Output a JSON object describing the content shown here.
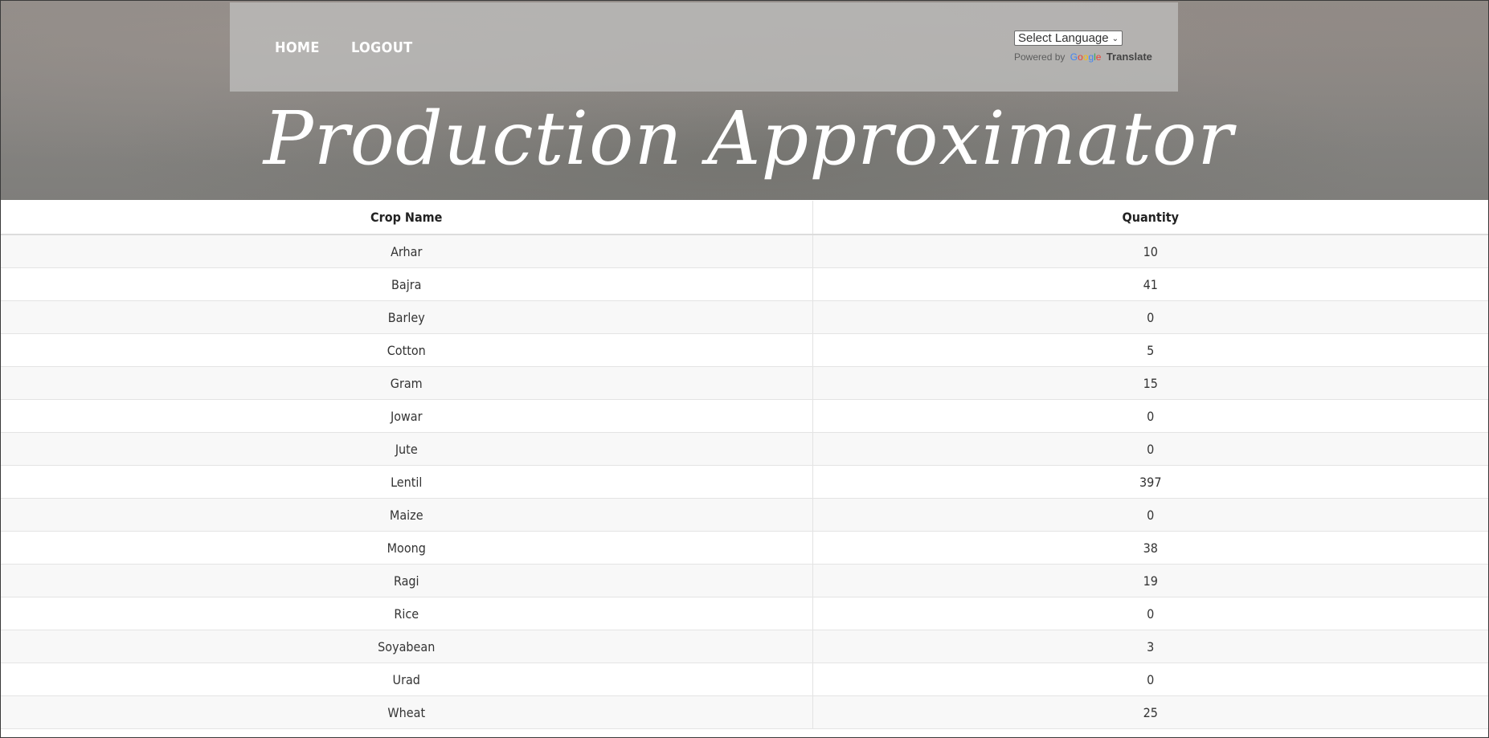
{
  "nav": {
    "home_label": "HOME",
    "logout_label": "LOGOUT"
  },
  "translate": {
    "select_value": "Select Language",
    "powered_by": "Powered by",
    "google_logo": "Google",
    "translate_label": "Translate"
  },
  "hero": {
    "title": "Production Approximator"
  },
  "table": {
    "headers": [
      "Crop Name",
      "Quantity"
    ],
    "rows": [
      [
        "Arhar",
        "10"
      ],
      [
        "Bajra",
        "41"
      ],
      [
        "Barley",
        "0"
      ],
      [
        "Cotton",
        "5"
      ],
      [
        "Gram",
        "15"
      ],
      [
        "Jowar",
        "0"
      ],
      [
        "Jute",
        "0"
      ],
      [
        "Lentil",
        "397"
      ],
      [
        "Maize",
        "0"
      ],
      [
        "Moong",
        "38"
      ],
      [
        "Ragi",
        "19"
      ],
      [
        "Rice",
        "0"
      ],
      [
        "Soyabean",
        "3"
      ],
      [
        "Urad",
        "0"
      ],
      [
        "Wheat",
        "25"
      ]
    ]
  },
  "colors": {
    "nav_text": "#ffffff",
    "title_text": "#ffffff",
    "table_text": "#333333",
    "stripe": "#f8f8f8"
  },
  "icons": {
    "select_caret": "chevron-down-icon"
  }
}
